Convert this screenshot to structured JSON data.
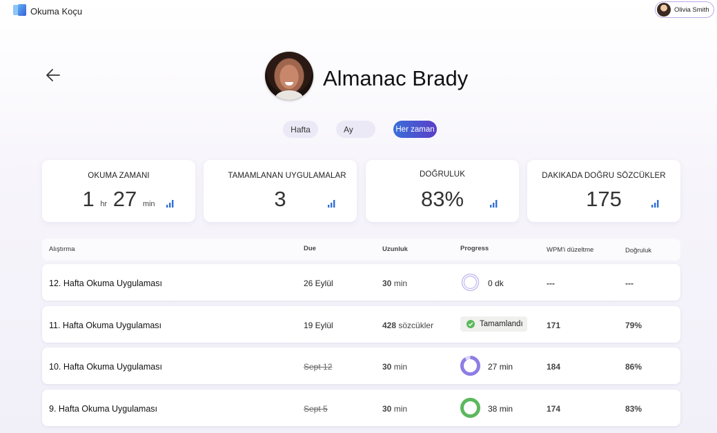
{
  "app": {
    "title": "Okuma Koçu"
  },
  "user": {
    "name": "Olivia Smith"
  },
  "student": {
    "name": "Almanac Brady"
  },
  "filters": [
    {
      "label": "Hafta",
      "selected": false
    },
    {
      "label": "Ay",
      "selected": false
    },
    {
      "label": "Her zaman",
      "selected": true
    }
  ],
  "stats": {
    "reading_time": {
      "label": "OKUMA ZAMANI",
      "hours": "1",
      "hours_unit": "hr",
      "minutes": "27",
      "minutes_unit": "min"
    },
    "completed": {
      "label": "TAMAMLANAN UYGULAMALAR",
      "value": "3"
    },
    "accuracy": {
      "label": "DOĞRULUK",
      "value": "83%"
    },
    "wcpm": {
      "label": "DAKIKADA DOĞRU SÖZCÜKLER",
      "value": "175"
    }
  },
  "table": {
    "headers": {
      "exercise": "Alıştırma",
      "due": "Due",
      "length": "Uzunluk",
      "progress": "Progress",
      "wpm": "WPM'i düzeltme",
      "accuracy": "Doğruluk"
    },
    "rows": [
      {
        "title": "12. Hafta Okuma Uygulaması",
        "due": "26 Eylül",
        "length_value": "30",
        "length_unit": "min",
        "progress_value": "0",
        "progress_unit": "dk",
        "progress_fraction": 0.0,
        "wpm": "---",
        "accuracy": "---"
      },
      {
        "title": "11. Hafta Okuma Uygulaması",
        "due": "19 Eylül",
        "length_value": "428",
        "length_unit": "sözcükler",
        "progress_label": "Tamamlandı",
        "wpm": "171",
        "accuracy": "79%"
      },
      {
        "title": "10. Hafta Okuma Uygulaması",
        "due": "Sept 12",
        "length_value": "30",
        "length_unit": "min",
        "progress_value": "27",
        "progress_unit": "min",
        "progress_fraction": 0.9,
        "wpm": "184",
        "accuracy": "86%"
      },
      {
        "title": "9. Hafta Okuma Uygulaması",
        "due": "Sept 5",
        "length_value": "30",
        "length_unit": "min",
        "progress_value": "38",
        "progress_unit": "min",
        "progress_fraction": 1.0,
        "wpm": "174",
        "accuracy": "83%"
      }
    ]
  },
  "colors": {
    "accent_start": "#3a6fd8",
    "accent_end": "#5a3ec8",
    "ring_purple": "#8d7de6",
    "ring_green": "#5cb85c",
    "bars_blue": "#2f6fd6"
  }
}
